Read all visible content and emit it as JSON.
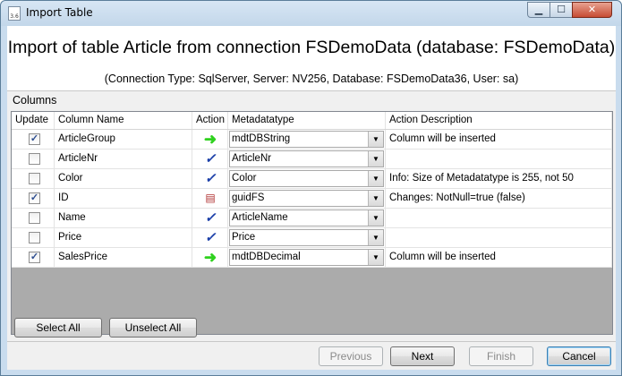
{
  "window": {
    "title": "Import Table",
    "icon_label": "3.6",
    "close_glyph": "✕",
    "min_glyph": "▁",
    "max_glyph": "☐"
  },
  "header": {
    "title": "Import of table Article from connection FSDemoData (database: FSDemoData)",
    "subtitle": "(Connection Type: SqlServer, Server: NV256, Database: FSDemoData36, User: sa)"
  },
  "columns_label": "Columns",
  "grid": {
    "headers": [
      "Update",
      "Column Name",
      "Action",
      "Metadatatype",
      "Action Description"
    ],
    "rows": [
      {
        "update": true,
        "check_glyph": "✓",
        "column_name": "ArticleGroup",
        "action_icon": "green-arrow-icon",
        "action_glyph": "➜",
        "metadatatype": "mdtDBString",
        "description": "Column will be inserted"
      },
      {
        "update": false,
        "check_glyph": "",
        "column_name": "ArticleNr",
        "action_icon": "blue-check-icon",
        "action_glyph": "✓",
        "metadatatype": "ArticleNr",
        "description": ""
      },
      {
        "update": false,
        "check_glyph": "",
        "column_name": "Color",
        "action_icon": "blue-check-icon",
        "action_glyph": "✓",
        "metadatatype": "Color",
        "description": "Info: Size of Metadatatype is 255, not 50"
      },
      {
        "update": true,
        "check_glyph": "✓",
        "column_name": "ID",
        "action_icon": "document-icon",
        "action_glyph": "▤",
        "metadatatype": "guidFS",
        "description": "Changes: NotNull=true (false)"
      },
      {
        "update": false,
        "check_glyph": "",
        "column_name": "Name",
        "action_icon": "blue-check-icon",
        "action_glyph": "✓",
        "metadatatype": "ArticleName",
        "description": ""
      },
      {
        "update": false,
        "check_glyph": "",
        "column_name": "Price",
        "action_icon": "blue-check-icon",
        "action_glyph": "✓",
        "metadatatype": "Price",
        "description": ""
      },
      {
        "update": true,
        "check_glyph": "✓",
        "column_name": "SalesPrice",
        "action_icon": "green-arrow-icon",
        "action_glyph": "➜",
        "metadatatype": "mdtDBDecimal",
        "description": "Column will be inserted"
      }
    ],
    "dropdown_glyph": "▼"
  },
  "buttons": {
    "select_all": "Select All",
    "unselect_all": "Unselect All",
    "previous": "Previous",
    "next": "Next",
    "finish": "Finish",
    "cancel": "Cancel"
  }
}
